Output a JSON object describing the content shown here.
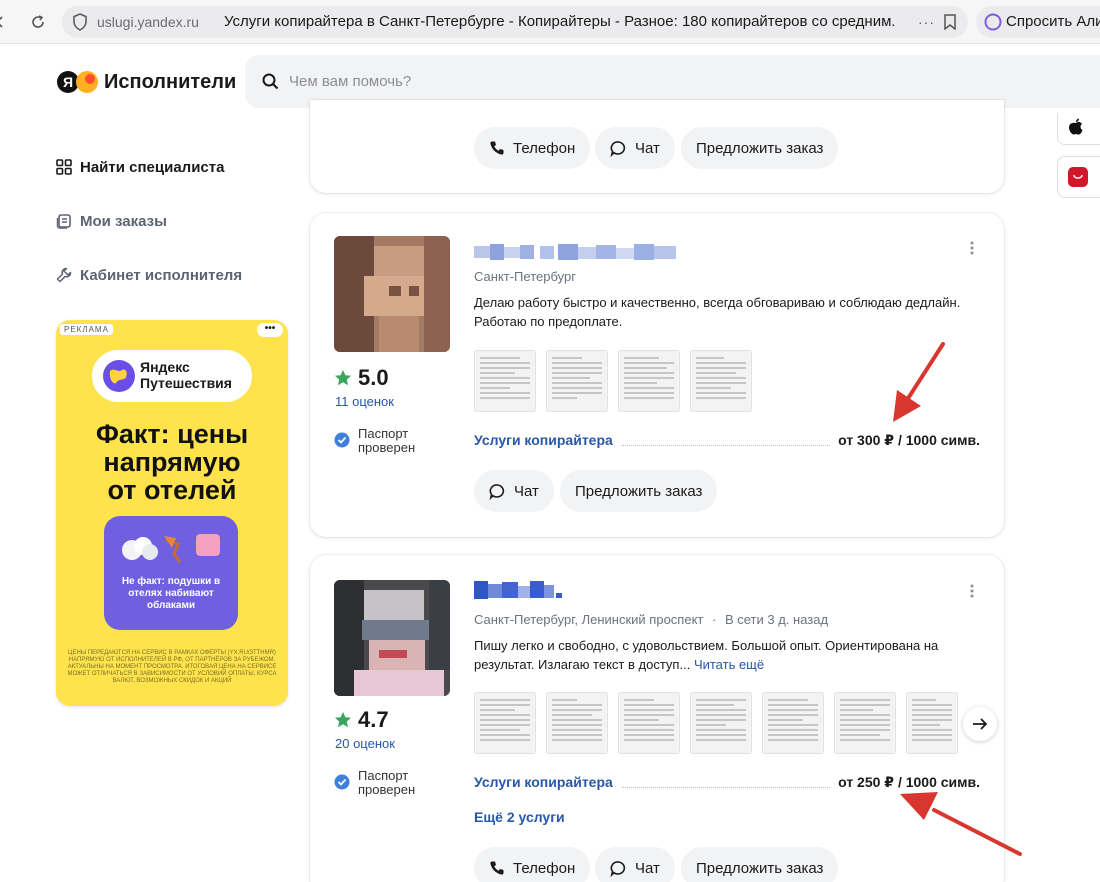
{
  "browser": {
    "domain": "uslugi.yandex.ru",
    "tab_title": "Услуги копирайтера в Санкт-Петербурге - Копирайтеры - Разное: 180 копирайтеров со средним...",
    "alice_label": "Спросить Али"
  },
  "header": {
    "logo_text": "Исполнители",
    "search_placeholder": "Чем вам помочь?"
  },
  "sidebar": {
    "items": [
      {
        "label": "Найти специалиста"
      },
      {
        "label": "Мои заказы"
      },
      {
        "label": "Кабинет исполнителя"
      }
    ]
  },
  "ad": {
    "tag": "РЕКЛАМА",
    "dots": "•••",
    "brand": "Яндекс\nПутешествия",
    "headline": "Факт: цены\nнапрямую\nот отелей",
    "box_text": "Не факт: подушки в отелях набивают облаками",
    "fine_print": "Цены передаются на сервис в рамках оферты (yx.ru/3tthMR) напрямую от исполнителей в РФ, от партнёров за рубежом. Актуальны на момент просмотра. Итоговая цена на сервисе может отличаться в зависимости от условий оплаты, курса валют, возможных скидок и акций"
  },
  "cards": [
    {
      "buttons": [
        "Телефон",
        "Чат",
        "Предложить заказ"
      ]
    },
    {
      "rating": "5.0",
      "reviews": "11 оценок",
      "verified": "Паспорт\nпроверен",
      "location": "Санкт-Петербург",
      "description": "Делаю работу быстро и качественно, всегда обговариваю и соблюдаю дедлайн. Работаю по предоплате.",
      "service_name": "Услуги копирайтера",
      "service_price": "от 300 ₽ / 1000 симв.",
      "buttons": [
        "Чат",
        "Предложить заказ"
      ]
    },
    {
      "rating": "4.7",
      "reviews": "20 оценок",
      "verified": "Паспорт\nпроверен",
      "location": "Санкт-Петербург, Ленинский проспект",
      "online": "В сети 3 д. назад",
      "description": "Пишу легко и свободно, с удовольствием. Большой опыт. Ориентирована на результат. Излагаю текст в доступ...",
      "read_more": "Читать ещё",
      "service_name": "Услуги копирайтера",
      "service_price": "от 250 ₽ / 1000 симв.",
      "more_services": "Ещё 2 услуги",
      "buttons": [
        "Телефон",
        "Чат",
        "Предложить заказ"
      ]
    }
  ],
  "colors": {
    "link": "#2757a8",
    "star": "#3aa55c",
    "verified": "#3f7fde",
    "ad_bg": "#ffe34d",
    "arrow": "#d9362f"
  }
}
